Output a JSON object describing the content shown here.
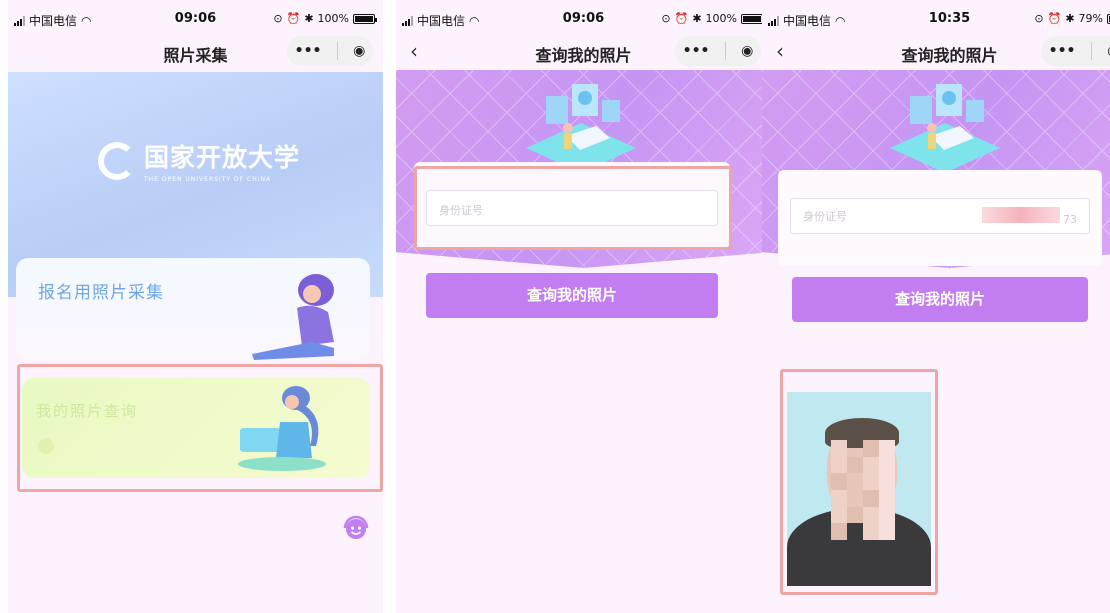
{
  "phones": [
    {
      "status": {
        "carrier": "中国电信",
        "time": "09:06",
        "battery": "100%",
        "battery_level": 1.0
      },
      "nav": {
        "title": "照片采集",
        "dots": "•••"
      },
      "banner": {
        "logo_cn": "国家开放大学",
        "logo_en": "THE OPEN UNIVERSITY OF CHINA"
      },
      "cards": [
        {
          "label": "报名用照片采集"
        },
        {
          "label": "我的照片查询"
        }
      ]
    },
    {
      "status": {
        "carrier": "中国电信",
        "time": "09:06",
        "battery": "100%",
        "battery_level": 1.0
      },
      "nav": {
        "title": "查询我的照片",
        "back": "‹",
        "dots": "•••"
      },
      "input": {
        "placeholder": "身份证号"
      },
      "button": {
        "label": "查询我的照片"
      }
    },
    {
      "status": {
        "carrier": "中国电信",
        "time": "10:35",
        "battery": "79%",
        "battery_level": 0.79
      },
      "nav": {
        "title": "查询我的照片",
        "back": "‹",
        "dots": "•••"
      },
      "input": {
        "label": "身份证号",
        "suffix": "73"
      },
      "button": {
        "label": "查询我的照片"
      },
      "result": {
        "photo_icon": "id-photo"
      }
    }
  ],
  "colors": {
    "accent": "#c27df0",
    "highlight": "#f0a5a5",
    "banner_purple": "#d39cf2",
    "banner_blue": "#c7dcfb"
  }
}
